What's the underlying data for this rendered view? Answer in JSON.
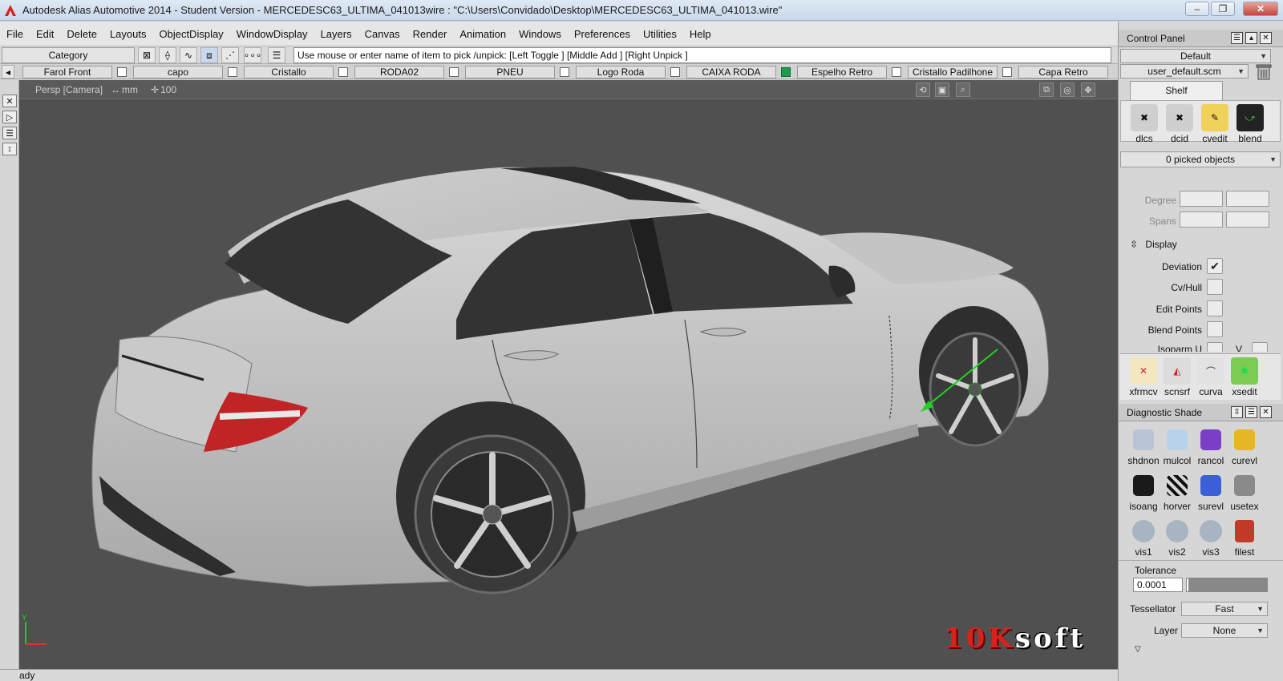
{
  "window": {
    "title": "Autodesk Alias Automotive 2014   - Student Version   - MERCEDESC63_ULTIMA_041013wire : \"C:\\Users\\Convidado\\Desktop\\MERCEDESC63_ULTIMA_041013.wire\"",
    "minimize": "–",
    "restore": "❐",
    "close": "✕",
    "accent": "#d6231e"
  },
  "menu": [
    "File",
    "Edit",
    "Delete",
    "Layouts",
    "ObjectDisplay",
    "WindowDisplay",
    "Layers",
    "Canvas",
    "Render",
    "Animation",
    "Windows",
    "Preferences",
    "Utilities",
    "Help"
  ],
  "toolbar": {
    "category": "Category",
    "prompt": "Use mouse or enter name of item to pick /unpick: [Left Toggle ] [Middle Add ] [Right Unpick ]"
  },
  "layers": [
    {
      "name": "Farol Front",
      "checked": false
    },
    {
      "name": "capo",
      "checked": false
    },
    {
      "name": "Cristallo",
      "checked": false
    },
    {
      "name": "RODA02",
      "checked": false
    },
    {
      "name": "PNEU",
      "checked": false
    },
    {
      "name": "Logo Roda",
      "checked": false
    },
    {
      "name": "CAIXA RODA",
      "checked": true
    },
    {
      "name": "Espelho Retro",
      "checked": false
    },
    {
      "name": "Cristallo Padilhone",
      "checked": false
    },
    {
      "name": "Capa Retro",
      "checked": false
    }
  ],
  "viewport": {
    "camera": "Persp [Camera]",
    "units": "mm",
    "scale": "100",
    "background": "#505050",
    "watermark_a": "10K",
    "watermark_b": "soft"
  },
  "status": "ady",
  "control_panel": {
    "title": "Control Panel",
    "preset": "Default",
    "shelf_file": "user_default.scm",
    "shelf_tab": "Shelf",
    "shelf_tools": [
      {
        "label": "dlcs",
        "icon": "delete-construction-icon"
      },
      {
        "label": "dcid",
        "icon": "delete-history-icon"
      },
      {
        "label": "cvedit",
        "icon": "cv-edit-icon"
      },
      {
        "label": "blend",
        "icon": "blend-curve-icon"
      }
    ],
    "picked": "0 picked objects",
    "degree_label": "Degree",
    "spans_label": "Spans",
    "display_label": "Display",
    "display_rows": [
      {
        "label": "Deviation",
        "checked": true
      },
      {
        "label": "Cv/Hull",
        "checked": false
      },
      {
        "label": "Edit Points",
        "checked": false
      },
      {
        "label": "Blend Points",
        "checked": false
      },
      {
        "label": "Isoparm U",
        "checked": false
      }
    ],
    "isoparm_v": "V",
    "tools_row": [
      {
        "label": "xfrmcv",
        "icon": "transform-cv-icon"
      },
      {
        "label": "scnsrf",
        "icon": "scan-surface-icon"
      },
      {
        "label": "curva",
        "icon": "curvature-icon"
      },
      {
        "label": "xsedit",
        "icon": "cross-section-edit-icon"
      }
    ]
  },
  "diagnostic": {
    "title": "Diagnostic Shade",
    "tools": [
      {
        "label": "shdnon",
        "color": "#b9c4d6"
      },
      {
        "label": "mulcol",
        "color": "#b8d2ea"
      },
      {
        "label": "rancol",
        "color": "#7a3fc6"
      },
      {
        "label": "curevl",
        "color": "#e8b624"
      },
      {
        "label": "isoang",
        "color": "#1a1a1a"
      },
      {
        "label": "horver",
        "color": "#d8d8d8"
      },
      {
        "label": "surevl",
        "color": "#3a5fd6"
      },
      {
        "label": "usetex",
        "color": "#8a8a8a"
      },
      {
        "label": "vis1",
        "color": "#a8b4c2"
      },
      {
        "label": "vis2",
        "color": "#a8b4c2"
      },
      {
        "label": "vis3",
        "color": "#a8b4c2"
      },
      {
        "label": "filest",
        "color": "#c23a2a"
      }
    ],
    "tolerance_label": "Tolerance",
    "tolerance_value": "0.0001",
    "tessellator_label": "Tessellator",
    "tessellator_value": "Fast",
    "layer_label": "Layer",
    "layer_value": "None"
  }
}
